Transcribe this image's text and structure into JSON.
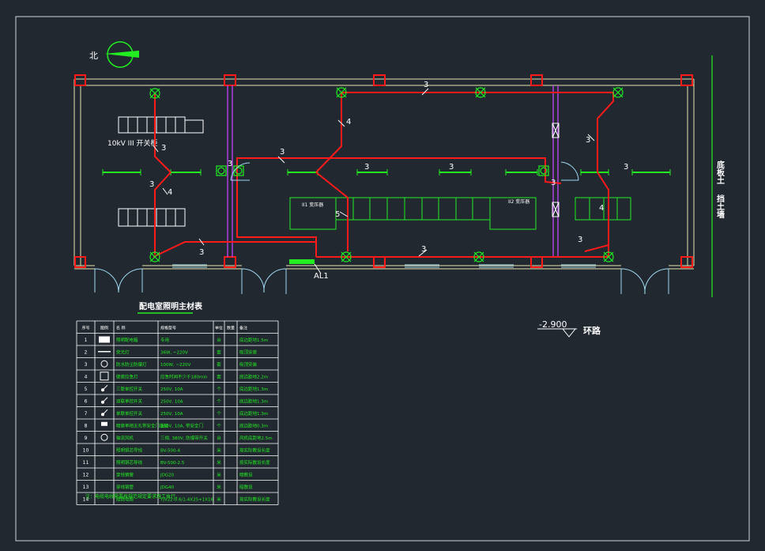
{
  "north_label": "北",
  "room_labels": {
    "hv_switchgear": "10kV III 开关柜",
    "transformer_1": "II1 变压器",
    "transformer_2": "II2 变压器",
    "panel_al1": "AL1",
    "wall_right_1": "底板土",
    "wall_right_2": "挡土墙"
  },
  "wire_counts": {
    "c3": "3",
    "c4": "4",
    "c5": "5"
  },
  "level": {
    "value": "-2.900",
    "label": "环路"
  },
  "table": {
    "title": "配电室照明主材表",
    "headers": [
      "序号",
      "图例",
      "名 称",
      "规格型号",
      "单位",
      "数量",
      "备注"
    ],
    "rows": [
      [
        "1",
        "",
        "照明配电箱",
        "专用",
        "台",
        "",
        "底边距地1.5m"
      ],
      [
        "2",
        "",
        "荧光灯",
        "36W, ~220V",
        "套",
        "",
        "吸顶安装"
      ],
      [
        "3",
        "",
        "防水防尘防爆灯",
        "100W, ~220V",
        "套",
        "",
        "吸顶安装"
      ],
      [
        "4",
        "",
        "壁装应急灯",
        "应急时间不少于180min",
        "套",
        "",
        "底边距地2.2m"
      ],
      [
        "5",
        "",
        "三联单控开关",
        "250V, 10A",
        "个",
        "",
        "底边距地1.3m"
      ],
      [
        "6",
        "",
        "双联单控开关",
        "250V, 10A",
        "个",
        "",
        "底边距地1.3m"
      ],
      [
        "7",
        "",
        "单联单控开关",
        "250V, 10A",
        "个",
        "",
        "底边距地1.3m"
      ],
      [
        "8",
        "",
        "暗装单相五孔带安全门插座",
        "250V, 10A, 带安全门",
        "个",
        "",
        "底边距地0.3m"
      ],
      [
        "9",
        "",
        "轴流风机",
        "三相, 380V, 防爆带开关",
        "台",
        "",
        "风机底距地2.5m"
      ],
      [
        "10",
        "",
        "照明铜芯导线",
        "BV-500-4",
        "米",
        "",
        "按实际敷设长度"
      ],
      [
        "11",
        "",
        "照明铜芯导线",
        "BV-500-2.5",
        "米",
        "",
        "按实际敷设长度"
      ],
      [
        "12",
        "",
        "穿线钢管",
        "JDG20",
        "米",
        "",
        "暗敷设"
      ],
      [
        "13",
        "",
        "穿线钢管",
        "JDG40",
        "米",
        "",
        "暗敷设"
      ],
      [
        "14",
        "",
        "阻燃电缆",
        "YJV22-0.6/1-4X25+1X16",
        "米",
        "",
        "按实际敷设长度"
      ]
    ],
    "note": "注：电缆电线需要按规范规定要求施工执行。"
  },
  "colors": {
    "background": "#212830",
    "wall": "#e8e4b0",
    "wire": "#ff1a1a",
    "column": "#ff1a1a",
    "green": "#22ee22",
    "purple": "#b040e0",
    "text": "#ffffff",
    "light_blue": "#9fd8f0",
    "frame": "#cfd6de"
  }
}
